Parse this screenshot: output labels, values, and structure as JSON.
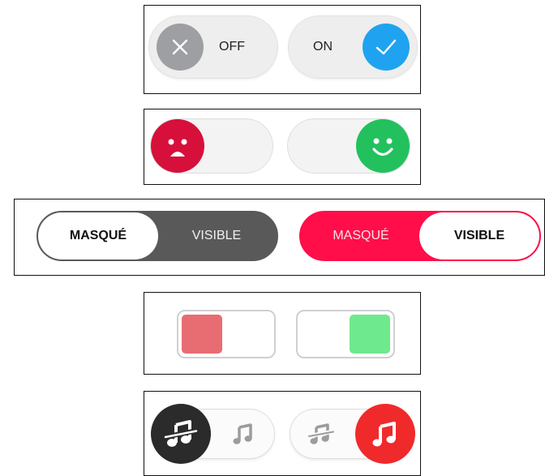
{
  "toggles_onoff": {
    "off_label": "OFF",
    "on_label": "ON",
    "off_color": "#9e9fa2",
    "on_color": "#1fa3f1",
    "off_icon": "close-icon",
    "on_icon": "check-icon"
  },
  "toggles_mood": {
    "off_icon": "sad-face-icon",
    "on_icon": "happy-face-icon",
    "off_color": "#d6103a",
    "on_color": "#22c15e"
  },
  "toggles_visibility": {
    "left_label": "MASQUÉ",
    "right_label": "VISIBLE",
    "dark_color": "#595959",
    "accent_color": "#ff0e49"
  },
  "toggles_square": {
    "off_color": "#e86d72",
    "on_color": "#6ee98d"
  },
  "toggles_music": {
    "muted_icon": "music-muted-icon",
    "music_icon": "music-note-icon",
    "off_color": "#2b2b2b",
    "on_color": "#f02a2b"
  }
}
